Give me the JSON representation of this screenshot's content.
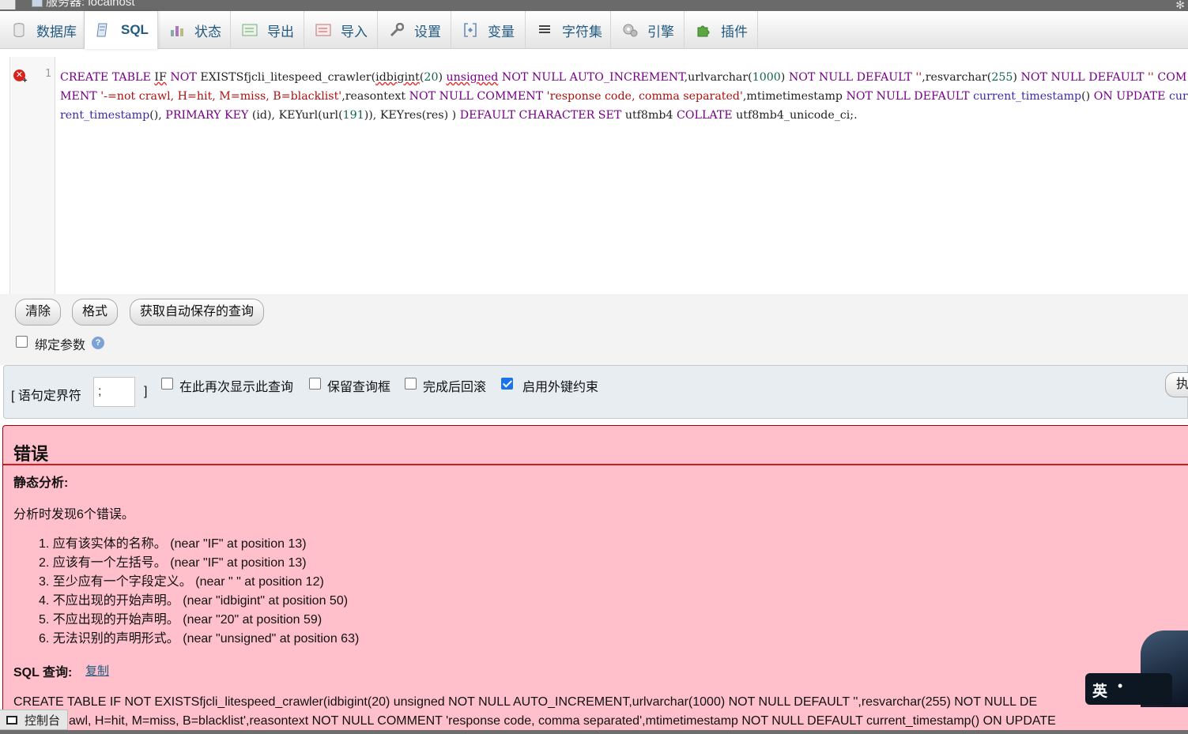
{
  "server_bar": {
    "title": "服务器: localhost"
  },
  "tabs": [
    {
      "label": "数据库",
      "icon": "database-icon"
    },
    {
      "label": "SQL",
      "icon": "sql-icon",
      "active": true
    },
    {
      "label": "状态",
      "icon": "status-icon"
    },
    {
      "label": "导出",
      "icon": "export-icon"
    },
    {
      "label": "导入",
      "icon": "import-icon"
    },
    {
      "label": "设置",
      "icon": "wrench-icon"
    },
    {
      "label": "变量",
      "icon": "variables-icon"
    },
    {
      "label": "字符集",
      "icon": "charset-icon"
    },
    {
      "label": "引擎",
      "icon": "engine-icon"
    },
    {
      "label": "插件",
      "icon": "plugin-icon"
    }
  ],
  "editor": {
    "line_number": "1",
    "query": "CREATE TABLE IF NOT EXISTSfjcli_litespeed_crawler(idbigint(20) unsigned NOT NULL AUTO_INCREMENT,urlvarchar(1000) NOT NULL DEFAULT '',resvarchar(255) NOT NULL DEFAULT '' COMMENT '-=not crawl, H=hit, M=miss, B=blacklist',reasontext NOT NULL COMMENT 'response code, comma separated',mtimetimestamp NOT NULL DEFAULT current_timestamp() ON UPDATE current_timestamp(), PRIMARY KEY (id), KEYurl(url(191)), KEYres(res) ) DEFAULT CHARACTER SET utf8mb4 COLLATE utf8mb4_unicode_ci;."
  },
  "buttons": {
    "clear": "清除",
    "format": "格式",
    "autosave": "获取自动保存的查询"
  },
  "bind_params": {
    "label": "绑定参数",
    "checked": false,
    "help": "?"
  },
  "options": {
    "delimiter_label": "[ 语句定界符",
    "delimiter_value": ";",
    "delimiter_close": "]",
    "show_again": {
      "label": "在此再次显示此查询",
      "checked": false
    },
    "retain_box": {
      "label": "保留查询框",
      "checked": false
    },
    "rollback": {
      "label": "完成后回滚",
      "checked": false
    },
    "foreign_keys": {
      "label": "启用外键约束",
      "checked": true
    },
    "execute": "执"
  },
  "error": {
    "title": "错误",
    "static_analysis": "静态分析:",
    "summary": "分析时发现6个错误。",
    "items": [
      "1. 应有该实体的名称。 (near \"IF\" at position 13)",
      "2. 应该有一个左括号。 (near \"IF\" at position 13)",
      "3. 至少应有一个字段定义。 (near \" \" at position 12)",
      "4. 不应出现的开始声明。 (near \"idbigint\" at position 50)",
      "5. 不应出现的开始声明。 (near \"20\" at position 59)",
      "6. 无法识别的声明形式。 (near \"unsigned\" at position 63)"
    ],
    "sql_label": "SQL 查询:",
    "copy_link": "复制",
    "sql_line1": "CREATE TABLE IF NOT EXISTSfjcli_litespeed_crawler(idbigint(20) unsigned NOT NULL AUTO_INCREMENT,urlvarchar(1000) NOT NULL DEFAULT '',resvarchar(255) NOT NULL DE",
    "sql_line2": "awl, H=hit, M=miss, B=blacklist',reasontext NOT NULL COMMENT 'response code, comma separated',mtimetimestamp NOT NULL DEFAULT current_timestamp() ON UPDATE"
  },
  "ime": {
    "label": "英",
    "dot": "•"
  },
  "console": {
    "label": "控制台"
  }
}
